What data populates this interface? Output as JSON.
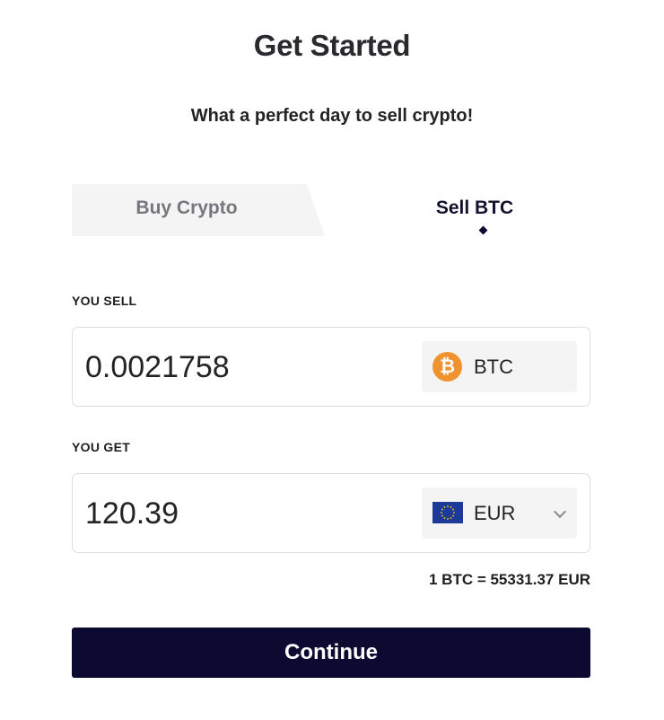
{
  "header": {
    "title": "Get Started",
    "subtitle": "What a perfect day to sell crypto!"
  },
  "tabs": [
    {
      "label": "Buy Crypto",
      "active": false
    },
    {
      "label": "Sell BTC",
      "active": true
    }
  ],
  "sell": {
    "label": "YOU SELL",
    "amount": "0.0021758",
    "currency_code": "BTC",
    "currency_icon": "bitcoin-icon",
    "icon_glyph": "₿",
    "icon_color": "#f0932f"
  },
  "get": {
    "label": "YOU GET",
    "amount": "120.39",
    "currency_code": "EUR",
    "currency_icon": "eu-flag-icon"
  },
  "rate": "1 BTC = 55331.37 EUR",
  "continue_label": "Continue",
  "colors": {
    "primary": "#0c0a30",
    "tab_inactive_bg": "#f4f4f5",
    "bitcoin": "#f0932f",
    "eu_flag_blue": "#1d3a99",
    "eu_flag_stars": "#f7d117"
  }
}
